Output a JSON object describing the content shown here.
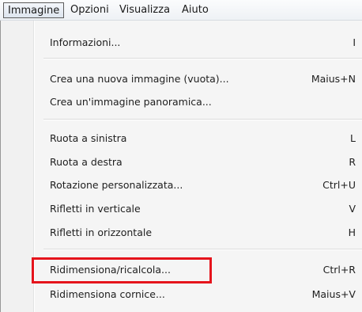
{
  "menubar": {
    "items": [
      {
        "label": "Immagine",
        "active": true
      },
      {
        "label": "Opzioni",
        "active": false
      },
      {
        "label": "Visualizza",
        "active": false
      },
      {
        "label": "Aiuto",
        "active": false
      }
    ]
  },
  "menu": {
    "items": [
      {
        "label": "Informazioni...",
        "shortcut": "I"
      },
      {
        "label": "Crea una nuova immagine (vuota)...",
        "shortcut": "Maius+N"
      },
      {
        "label": "Crea un'immagine panoramica...",
        "shortcut": ""
      },
      {
        "label": "Ruota a sinistra",
        "shortcut": "L"
      },
      {
        "label": "Ruota a destra",
        "shortcut": "R"
      },
      {
        "label": "Rotazione personalizzata...",
        "shortcut": "Ctrl+U"
      },
      {
        "label": "Rifletti in verticale",
        "shortcut": "V"
      },
      {
        "label": "Rifletti in orizzontale",
        "shortcut": "H"
      },
      {
        "label": "Ridimensiona/ricalcola...",
        "shortcut": "Ctrl+R"
      },
      {
        "label": "Ridimensiona cornice...",
        "shortcut": "Maius+V"
      }
    ]
  },
  "colors": {
    "highlight_border": "#e5141c",
    "menu_background": "#f5f5f5",
    "text": "#1e1e1e"
  }
}
